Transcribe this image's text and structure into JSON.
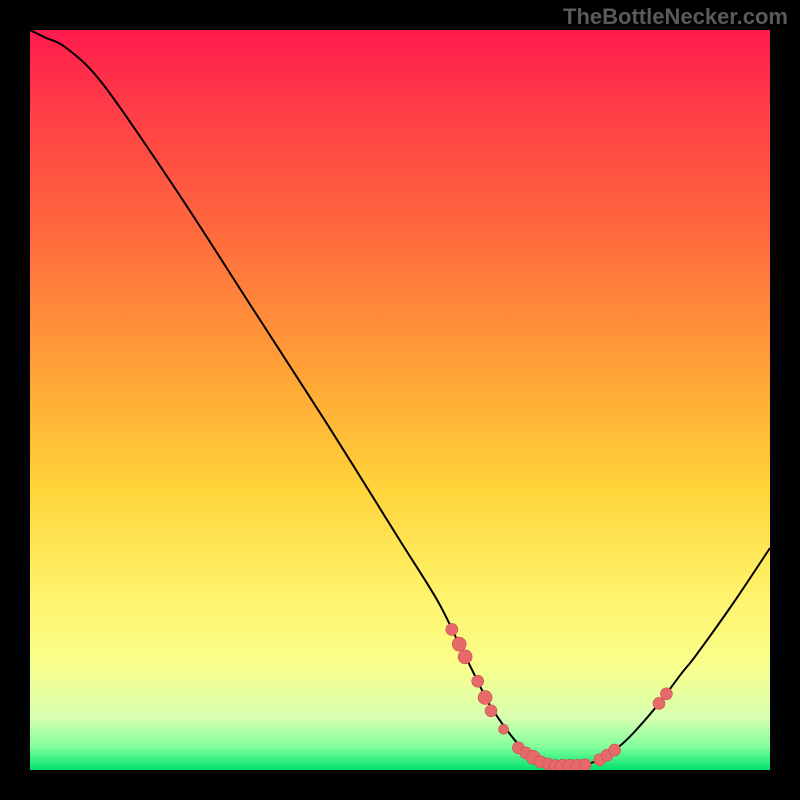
{
  "watermark": "TheBottleNecker.com",
  "colors": {
    "background": "#000000",
    "gradient_top": "#ff1a4d",
    "gradient_bottom": "#00e26a",
    "curve_stroke": "#000000",
    "marker_fill": "#e66a6a"
  },
  "chart_data": {
    "type": "line",
    "title": "",
    "xlabel": "",
    "ylabel": "",
    "xlim": [
      0,
      100
    ],
    "ylim": [
      0,
      100
    ],
    "annotations": [
      "TheBottleNecker.com"
    ],
    "curve_points": [
      {
        "x": 0.0,
        "y": 100.0
      },
      {
        "x": 2.0,
        "y": 99.0
      },
      {
        "x": 5.0,
        "y": 97.5
      },
      {
        "x": 10.0,
        "y": 92.5
      },
      {
        "x": 20.0,
        "y": 78.0
      },
      {
        "x": 30.0,
        "y": 62.5
      },
      {
        "x": 40.0,
        "y": 47.0
      },
      {
        "x": 50.0,
        "y": 31.0
      },
      {
        "x": 55.0,
        "y": 23.0
      },
      {
        "x": 58.0,
        "y": 17.0
      },
      {
        "x": 60.0,
        "y": 13.0
      },
      {
        "x": 62.0,
        "y": 9.0
      },
      {
        "x": 64.0,
        "y": 6.0
      },
      {
        "x": 66.0,
        "y": 3.5
      },
      {
        "x": 68.0,
        "y": 2.0
      },
      {
        "x": 70.0,
        "y": 1.0
      },
      {
        "x": 72.0,
        "y": 0.5
      },
      {
        "x": 74.0,
        "y": 0.5
      },
      {
        "x": 76.0,
        "y": 1.0
      },
      {
        "x": 78.0,
        "y": 2.0
      },
      {
        "x": 80.0,
        "y": 3.5
      },
      {
        "x": 82.0,
        "y": 5.5
      },
      {
        "x": 85.0,
        "y": 9.0
      },
      {
        "x": 88.0,
        "y": 13.0
      },
      {
        "x": 90.0,
        "y": 15.5
      },
      {
        "x": 95.0,
        "y": 22.5
      },
      {
        "x": 100.0,
        "y": 30.0
      }
    ],
    "markers": [
      {
        "x": 57.0,
        "y": 19.0,
        "size": 6
      },
      {
        "x": 58.0,
        "y": 17.0,
        "size": 7
      },
      {
        "x": 58.8,
        "y": 15.3,
        "size": 7
      },
      {
        "x": 60.5,
        "y": 12.0,
        "size": 6
      },
      {
        "x": 61.5,
        "y": 9.8,
        "size": 7
      },
      {
        "x": 62.3,
        "y": 8.0,
        "size": 6
      },
      {
        "x": 64.0,
        "y": 5.5,
        "size": 5
      },
      {
        "x": 66.0,
        "y": 3.0,
        "size": 6
      },
      {
        "x": 67.0,
        "y": 2.3,
        "size": 6
      },
      {
        "x": 68.0,
        "y": 1.7,
        "size": 7
      },
      {
        "x": 69.0,
        "y": 1.1,
        "size": 6
      },
      {
        "x": 70.0,
        "y": 0.8,
        "size": 6
      },
      {
        "x": 71.0,
        "y": 0.6,
        "size": 6
      },
      {
        "x": 72.0,
        "y": 0.5,
        "size": 7
      },
      {
        "x": 73.0,
        "y": 0.5,
        "size": 7
      },
      {
        "x": 74.0,
        "y": 0.5,
        "size": 7
      },
      {
        "x": 75.0,
        "y": 0.7,
        "size": 6
      },
      {
        "x": 77.0,
        "y": 1.4,
        "size": 6
      },
      {
        "x": 78.0,
        "y": 2.0,
        "size": 6
      },
      {
        "x": 79.0,
        "y": 2.7,
        "size": 6
      },
      {
        "x": 85.0,
        "y": 9.0,
        "size": 6
      },
      {
        "x": 86.0,
        "y": 10.3,
        "size": 6
      }
    ]
  }
}
